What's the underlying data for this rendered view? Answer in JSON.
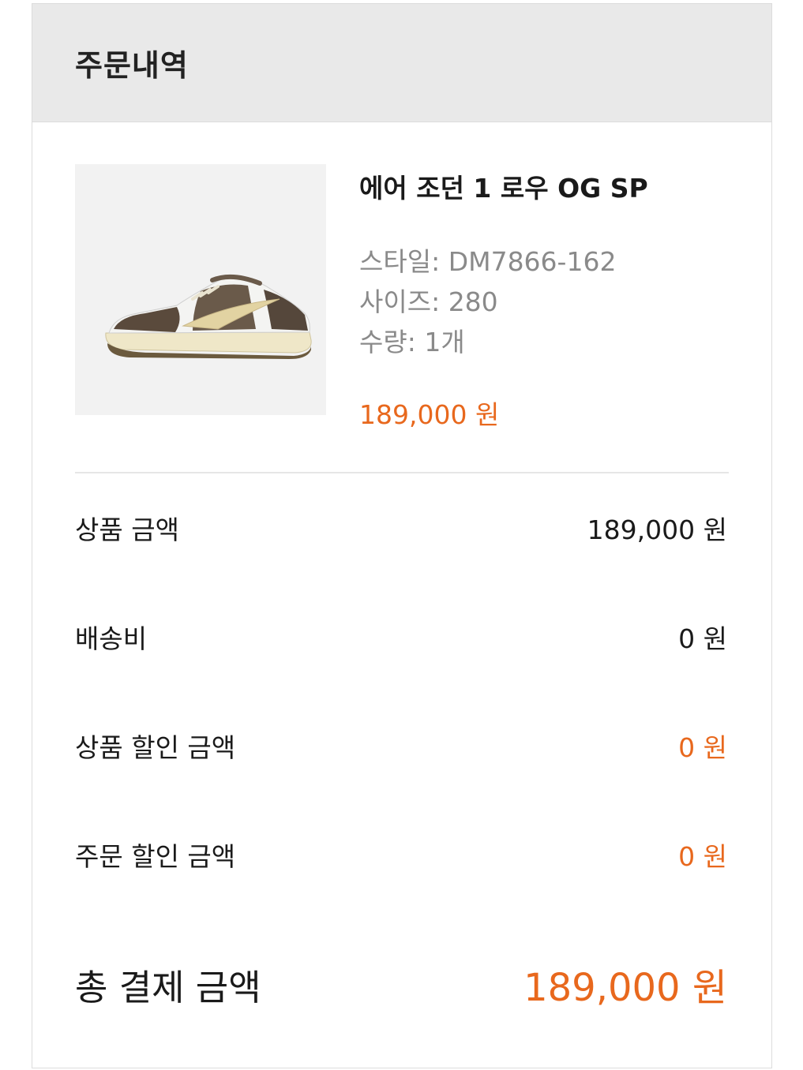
{
  "header": {
    "title": "주문내역"
  },
  "product": {
    "name": "에어 조던 1 로우 OG SP",
    "style": "스타일: DM7866-162",
    "size": "사이즈: 280",
    "quantity": "수량: 1개",
    "price": "189,000 원",
    "image_icon": "sneaker-image"
  },
  "summary": [
    {
      "label": "상품 금액",
      "value": "189,000 원"
    },
    {
      "label": "배송비",
      "value": "0 원"
    },
    {
      "label": "상품 할인 금액",
      "value": "0 원"
    },
    {
      "label": "주문 할인 금액",
      "value": "0 원"
    }
  ],
  "total": {
    "label": "총 결제 금액",
    "value": "189,000 원"
  },
  "colors": {
    "accent": "#e8681d",
    "header_bg": "#e9e9e9",
    "muted_text": "#8a8a8a"
  }
}
